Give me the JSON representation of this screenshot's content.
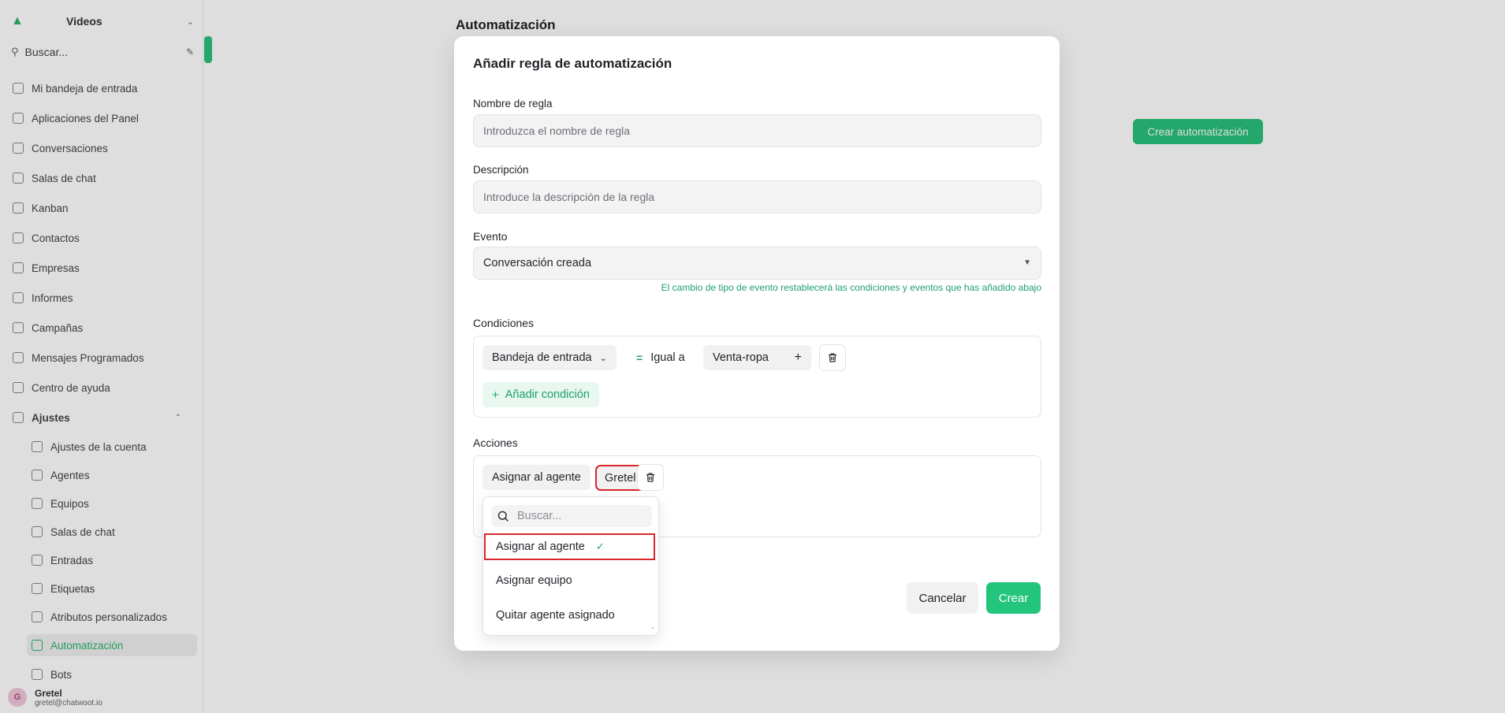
{
  "sidebar": {
    "account": "Videos",
    "search_placeholder": "Buscar...",
    "items": [
      {
        "label": "Mi bandeja de entrada"
      },
      {
        "label": "Aplicaciones del Panel"
      },
      {
        "label": "Conversaciones"
      },
      {
        "label": "Salas de chat"
      },
      {
        "label": "Kanban"
      },
      {
        "label": "Contactos"
      },
      {
        "label": "Empresas"
      },
      {
        "label": "Informes"
      },
      {
        "label": "Campañas"
      },
      {
        "label": "Mensajes Programados"
      },
      {
        "label": "Centro de ayuda"
      }
    ],
    "settings_label": "Ajustes",
    "settings_items": [
      {
        "label": "Ajustes de la cuenta"
      },
      {
        "label": "Agentes"
      },
      {
        "label": "Equipos"
      },
      {
        "label": "Salas de chat"
      },
      {
        "label": "Entradas"
      },
      {
        "label": "Etiquetas"
      },
      {
        "label": "Atributos personalizados"
      },
      {
        "label": "Automatización"
      },
      {
        "label": "Bots"
      }
    ],
    "user": {
      "name": "Gretel",
      "email": "gretel@chatwoot.io",
      "initial": "G"
    }
  },
  "page": {
    "title": "Automatización",
    "create_button": "Crear automatización"
  },
  "modal": {
    "title": "Añadir regla de automatización",
    "rule_name": {
      "label": "Nombre de regla",
      "placeholder": "Introduzca el nombre de regla",
      "value": ""
    },
    "description": {
      "label": "Descripción",
      "placeholder": "Introduce la descripción de la regla",
      "value": ""
    },
    "event": {
      "label": "Evento",
      "value": "Conversación creada",
      "help": "El cambio de tipo de evento restablecerá las condiciones y eventos que has añadido abajo"
    },
    "conditions": {
      "label": "Condiciones",
      "attribute": "Bandeja de entrada",
      "operator": "Igual a",
      "value": "Venta-ropa",
      "add_label": "Añadir condición"
    },
    "actions": {
      "label": "Acciones",
      "action": "Asignar al agente",
      "value": "Gretel"
    },
    "cancel_label": "Cancelar",
    "create_label": "Crear"
  },
  "dropdown": {
    "search_placeholder": "Buscar...",
    "options": [
      {
        "label": "Asignar al agente",
        "selected": true
      },
      {
        "label": "Asignar equipo",
        "selected": false
      },
      {
        "label": "Quitar agente asignado",
        "selected": false
      }
    ]
  },
  "colors": {
    "accent": "#22c57b",
    "highlight": "#d8252a"
  }
}
